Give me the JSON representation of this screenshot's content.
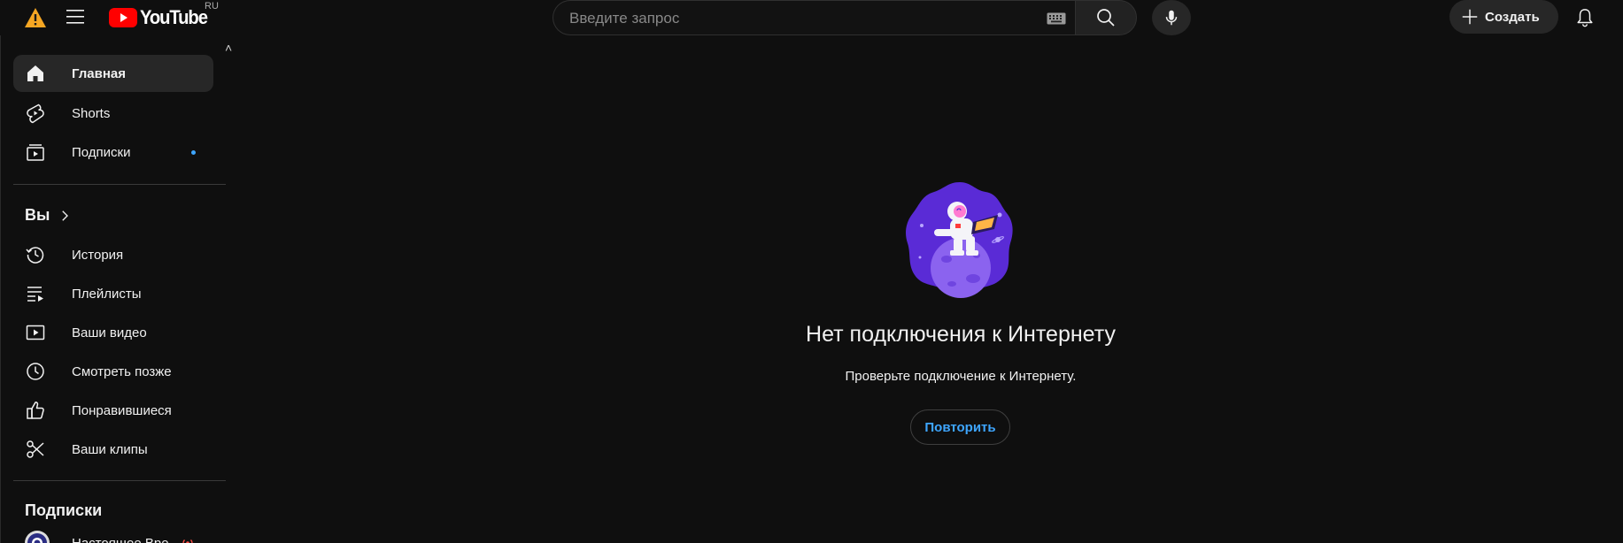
{
  "header": {
    "logo_text": "YouTube",
    "region_code": "RU",
    "search_placeholder": "Введите запрос",
    "create_label": "Создать",
    "icons": [
      "warning-icon",
      "menu-icon",
      "keyboard-icon",
      "search-icon",
      "microphone-icon",
      "plus-icon",
      "bell-icon"
    ]
  },
  "sidebar": {
    "main_items": [
      {
        "label": "Главная",
        "icon": "home-icon",
        "active": true
      },
      {
        "label": "Shorts",
        "icon": "shorts-icon"
      },
      {
        "label": "Подписки",
        "icon": "subscriptions-icon",
        "has_new": true
      }
    ],
    "you_section": {
      "title": "Вы",
      "items": [
        {
          "label": "История",
          "icon": "history-icon"
        },
        {
          "label": "Плейлисты",
          "icon": "playlists-icon"
        },
        {
          "label": "Ваши видео",
          "icon": "your-videos-icon"
        },
        {
          "label": "Смотреть позже",
          "icon": "watch-later-icon"
        },
        {
          "label": "Понравившиеся",
          "icon": "like-icon"
        },
        {
          "label": "Ваши клипы",
          "icon": "clips-icon"
        }
      ]
    },
    "subscriptions_section": {
      "title": "Подписки",
      "items": [
        {
          "label": "Настоящее Вре",
          "icon": "channel-avatar",
          "live": true
        }
      ]
    }
  },
  "main": {
    "offline_title": "Нет подключения к Интернету",
    "offline_subtitle": "Проверьте подключение к Интернету.",
    "retry_label": "Повторить"
  },
  "colors": {
    "background": "#0f0f0f",
    "surface": "#272727",
    "accent_blue": "#3ea6ff",
    "brand_red": "#ff0000",
    "illustration_purple": "#5a2bd6"
  }
}
